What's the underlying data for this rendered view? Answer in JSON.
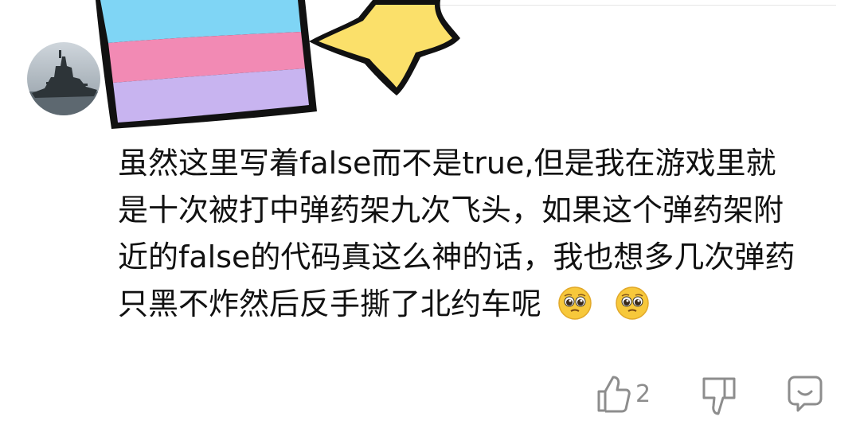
{
  "comment": {
    "lines": [
      "虽然这里写着false而不是true,但是我在游戏里就",
      "是十次被打中弹药架九次飞头，如果这个弹药架附",
      "近的false的代码真这么神的话，我也想多几次弹药",
      "只黑不炸然后反手撕了北约车呢"
    ]
  },
  "actions": {
    "like_icon": "thumbs-up-icon",
    "like_count": "2",
    "dislike_icon": "thumbs-down-icon",
    "reply_icon": "comment-bubble-icon"
  },
  "avatar_icon": "battleship-avatar",
  "sticker_icon": "rainbow-shooting-star-sticker",
  "emojis": [
    "pleading-face-emoji",
    "pleading-face-emoji"
  ]
}
